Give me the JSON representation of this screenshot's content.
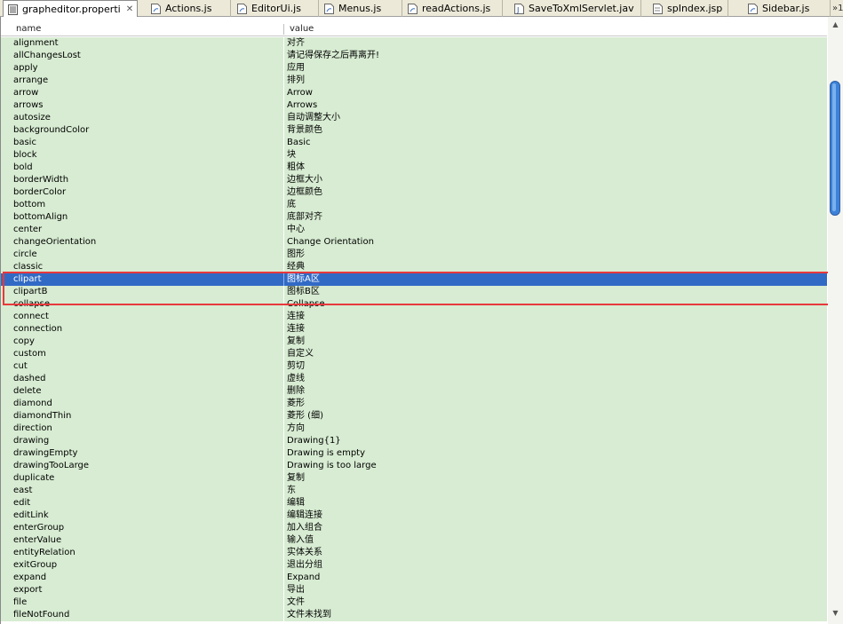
{
  "tabs": [
    {
      "label": "grapheditor.properti",
      "active": true
    },
    {
      "label": "Actions.js"
    },
    {
      "label": "EditorUi.js"
    },
    {
      "label": "Menus.js"
    },
    {
      "label": "readActions.js"
    },
    {
      "label": "SaveToXmlServlet.jav"
    },
    {
      "label": "spIndex.jsp"
    },
    {
      "label": "Sidebar.js"
    }
  ],
  "overflow_label": "»1",
  "columns": {
    "name": "name",
    "value": "value"
  },
  "rows": [
    [
      "alignment",
      "对齐"
    ],
    [
      "allChangesLost",
      "请记得保存之后再离开!"
    ],
    [
      "apply",
      "应用"
    ],
    [
      "arrange",
      "排列"
    ],
    [
      "arrow",
      "Arrow"
    ],
    [
      "arrows",
      "Arrows"
    ],
    [
      "autosize",
      "自动调整大小"
    ],
    [
      "backgroundColor",
      "背景颜色"
    ],
    [
      "basic",
      "Basic"
    ],
    [
      "block",
      "块"
    ],
    [
      "bold",
      "粗体"
    ],
    [
      "borderWidth",
      "边框大小"
    ],
    [
      "borderColor",
      "边框颜色"
    ],
    [
      "bottom",
      "底"
    ],
    [
      "bottomAlign",
      "底部对齐"
    ],
    [
      "center",
      "中心"
    ],
    [
      "changeOrientation",
      "Change Orientation"
    ],
    [
      "circle",
      "图形"
    ],
    [
      "classic",
      "经典"
    ],
    [
      "clipart",
      "图标A区"
    ],
    [
      "clipartB",
      "图标B区"
    ],
    [
      "collapse",
      "Collapse"
    ],
    [
      "connect",
      "连接"
    ],
    [
      "connection",
      "连接"
    ],
    [
      "copy",
      "复制"
    ],
    [
      "custom",
      "自定义"
    ],
    [
      "cut",
      "剪切"
    ],
    [
      "dashed",
      "虚线"
    ],
    [
      "delete",
      "删除"
    ],
    [
      "diamond",
      "菱形"
    ],
    [
      "diamondThin",
      "菱形 (细)"
    ],
    [
      "direction",
      "方向"
    ],
    [
      "drawing",
      "Drawing{1}"
    ],
    [
      "drawingEmpty",
      "Drawing is empty"
    ],
    [
      "drawingTooLarge",
      "Drawing is too large"
    ],
    [
      "duplicate",
      "复制"
    ],
    [
      "east",
      "东"
    ],
    [
      "edit",
      "编辑"
    ],
    [
      "editLink",
      "编辑连接"
    ],
    [
      "enterGroup",
      "加入组合"
    ],
    [
      "enterValue",
      "输入值"
    ],
    [
      "entityRelation",
      "实体关系"
    ],
    [
      "exitGroup",
      "退出分组"
    ],
    [
      "expand",
      "Expand"
    ],
    [
      "export",
      "导出"
    ],
    [
      "file",
      "文件"
    ],
    [
      "fileNotFound",
      "文件未找到"
    ]
  ],
  "selected_row": "clipart",
  "colors": {
    "row_bg": "#d7ecd2",
    "selection": "#316ac5",
    "highlight_box": "#e8383c"
  }
}
